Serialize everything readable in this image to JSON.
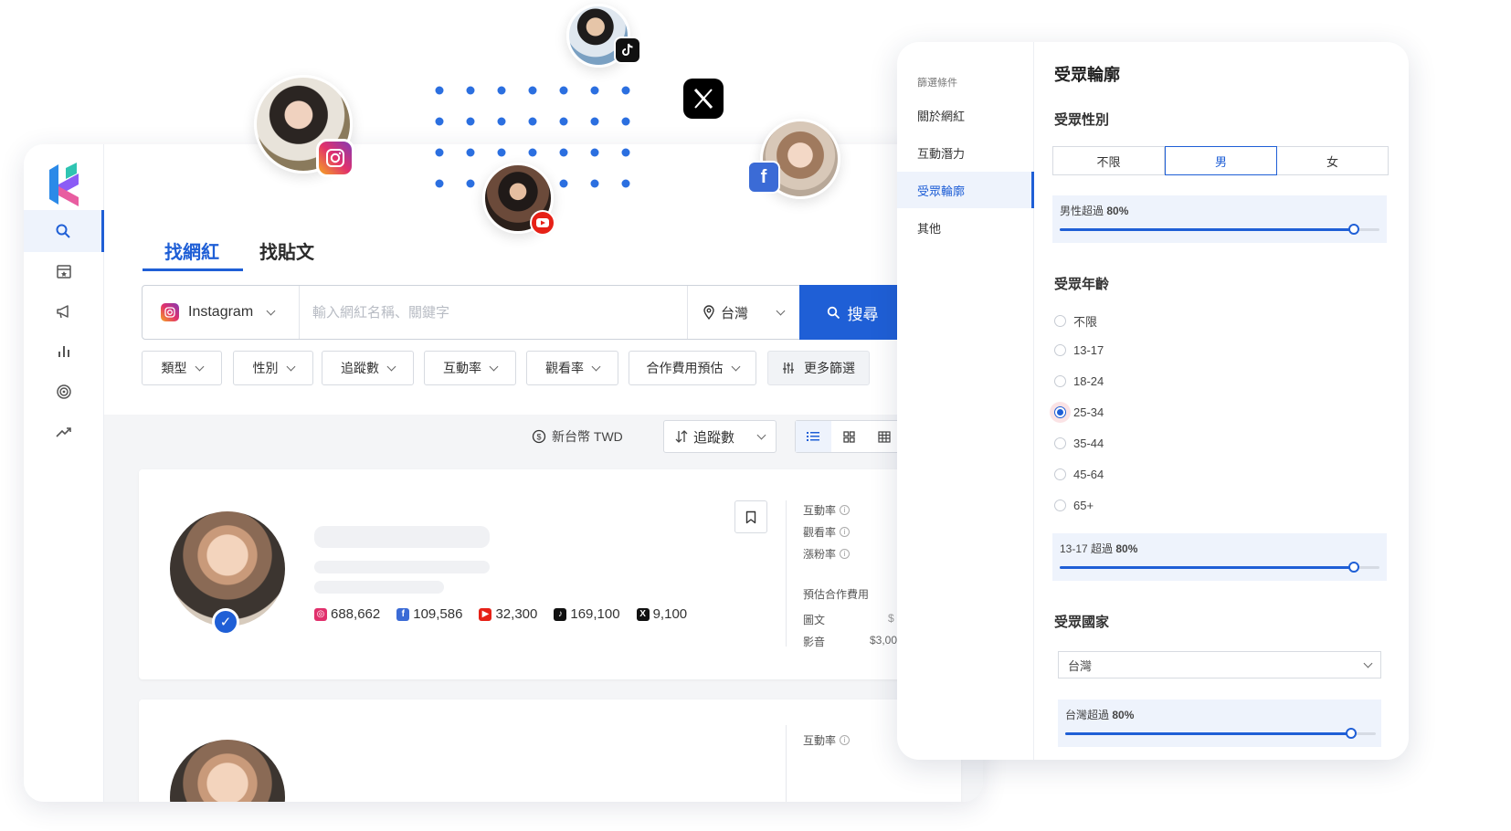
{
  "tabs": {
    "influencers": "找網紅",
    "posts": "找貼文"
  },
  "search": {
    "platform": "Instagram",
    "placeholder": "輸入網紅名稱、關鍵字",
    "region": "台灣",
    "button": "搜尋"
  },
  "filters": [
    "類型",
    "性別",
    "追蹤數",
    "互動率",
    "觀看率",
    "合作費用預估",
    "更多篩選"
  ],
  "toolbar": {
    "currency": "新台幣 TWD",
    "sort": "追蹤數"
  },
  "card": {
    "stats": [
      {
        "platform": "instagram",
        "value": "688,662",
        "color": "#e1306c"
      },
      {
        "platform": "facebook",
        "value": "109,586",
        "color": "#3b6bd6"
      },
      {
        "platform": "youtube",
        "value": "32,300",
        "color": "#e62117"
      },
      {
        "platform": "tiktok",
        "value": "169,100",
        "color": "#111111"
      },
      {
        "platform": "x",
        "value": "9,100",
        "color": "#111111"
      }
    ],
    "metrics": {
      "engagement": "互動率",
      "view_rate": "觀看率",
      "growth": "漲粉率"
    },
    "pricing": {
      "title": "預估合作費用",
      "image_post": "圖文",
      "video": "影音",
      "image_price": "$",
      "video_price": "$3,00"
    }
  },
  "card2": {
    "engagement": "互動率"
  },
  "panel": {
    "nav_head": "篩選條件",
    "nav": [
      "關於網紅",
      "互動潛力",
      "受眾輪廓",
      "其他"
    ],
    "title": "受眾輪廓",
    "gender": {
      "title": "受眾性別",
      "options": [
        "不限",
        "男",
        "女"
      ],
      "selected": "男",
      "slider_label": "男性超過",
      "slider_value": "80%",
      "slider_fraction": 0.92
    },
    "age": {
      "title": "受眾年齡",
      "options": [
        "不限",
        "13-17",
        "18-24",
        "25-34",
        "35-44",
        "45-64",
        "65+"
      ],
      "selected": "25-34",
      "slider_label": "13-17 超過",
      "slider_value": "80%",
      "slider_fraction": 0.92
    },
    "country": {
      "title": "受眾國家",
      "selected": "台灣",
      "slider_label": "台灣超過",
      "slider_value": "80%",
      "slider_fraction": 0.92
    }
  },
  "colors": {
    "accent": "#1f5fd6",
    "accent_bg": "#eef3fc"
  }
}
